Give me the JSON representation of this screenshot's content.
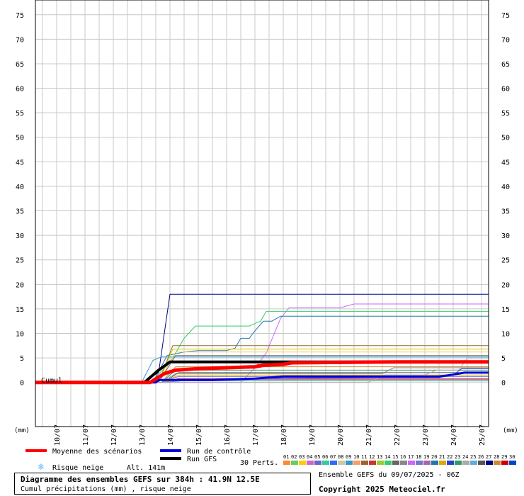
{
  "chart_data": {
    "type": "line",
    "y_ticks": [
      0,
      5,
      10,
      15,
      20,
      25,
      30,
      35,
      40,
      45,
      50,
      55,
      60,
      65,
      70,
      75
    ],
    "ylim": [
      -9,
      78
    ],
    "y_unit_label": "(mm)",
    "series_start_label": "Cumul",
    "x_tick_labels": [
      "10/07",
      "11/07",
      "12/07",
      "13/07",
      "14/07",
      "15/07",
      "16/07",
      "17/07",
      "18/07",
      "19/07",
      "20/07",
      "21/07",
      "22/07",
      "23/07",
      "24/07",
      "25/07"
    ],
    "x_tick_days": [
      1,
      2,
      3,
      4,
      5,
      6,
      7,
      8,
      9,
      10,
      11,
      12,
      13,
      14,
      15,
      16
    ],
    "x_day_range": [
      0.25,
      16.25
    ],
    "grid": true,
    "series": [
      {
        "color": "#00008b",
        "width": 1,
        "points": [
          [
            0.25,
            0
          ],
          [
            4.0,
            0
          ],
          [
            4.6,
            2
          ],
          [
            5.0,
            18
          ],
          [
            16.25,
            18
          ]
        ]
      },
      {
        "color": "#cc66ff",
        "width": 1,
        "points": [
          [
            0.25,
            0
          ],
          [
            7.5,
            0
          ],
          [
            8.0,
            3
          ],
          [
            8.4,
            6
          ],
          [
            8.9,
            13
          ],
          [
            9.2,
            15.2
          ],
          [
            11.0,
            15.2
          ],
          [
            11.5,
            16
          ],
          [
            16.25,
            16
          ]
        ]
      },
      {
        "color": "#33cc66",
        "width": 1,
        "points": [
          [
            0.25,
            0
          ],
          [
            4.3,
            0
          ],
          [
            5.0,
            4
          ],
          [
            5.5,
            9
          ],
          [
            5.9,
            11.5
          ],
          [
            7.8,
            11.5
          ],
          [
            8.2,
            12.5
          ],
          [
            8.4,
            14.5
          ],
          [
            16.25,
            14.5
          ]
        ]
      },
      {
        "color": "#2277aa",
        "width": 1,
        "points": [
          [
            0.25,
            0
          ],
          [
            4.4,
            0
          ],
          [
            4.9,
            5.5
          ],
          [
            5.5,
            6.2
          ],
          [
            6.0,
            6.5
          ],
          [
            7.0,
            6.5
          ],
          [
            7.3,
            7
          ],
          [
            7.5,
            9
          ],
          [
            7.8,
            9
          ],
          [
            8.0,
            10.5
          ],
          [
            8.3,
            12.5
          ],
          [
            8.6,
            12.5
          ],
          [
            8.9,
            13.5
          ],
          [
            16.25,
            13.5
          ]
        ]
      },
      {
        "color": "#3399cc",
        "width": 1,
        "points": [
          [
            0.25,
            0
          ],
          [
            4.0,
            0
          ],
          [
            4.4,
            4.5
          ],
          [
            4.7,
            5.2
          ],
          [
            16.25,
            5.2
          ]
        ]
      },
      {
        "color": "#996633",
        "width": 1,
        "points": [
          [
            0.25,
            0
          ],
          [
            4.6,
            0
          ],
          [
            5.1,
            7.5
          ],
          [
            16.25,
            7.5
          ]
        ]
      },
      {
        "color": "#cccc00",
        "width": 1,
        "points": [
          [
            0.25,
            0
          ],
          [
            4.6,
            0
          ],
          [
            5.1,
            6.8
          ],
          [
            16.25,
            6.8
          ]
        ]
      },
      {
        "color": "#ffcc66",
        "width": 1,
        "points": [
          [
            0.25,
            0
          ],
          [
            4.6,
            0
          ],
          [
            5.2,
            6.2
          ],
          [
            16.25,
            6.2
          ]
        ]
      },
      {
        "color": "#666666",
        "width": 1,
        "points": [
          [
            0.25,
            0
          ],
          [
            4.6,
            0
          ],
          [
            5.2,
            5.5
          ],
          [
            16.25,
            5.5
          ]
        ]
      },
      {
        "color": "#cc8833",
        "width": 1,
        "points": [
          [
            0.25,
            0
          ],
          [
            4.7,
            0
          ],
          [
            5.2,
            3.2
          ],
          [
            16.25,
            3.2
          ]
        ]
      },
      {
        "color": "#339966",
        "width": 1,
        "points": [
          [
            0.25,
            0
          ],
          [
            4.7,
            0
          ],
          [
            5.2,
            2.5
          ],
          [
            16.25,
            2.5
          ]
        ]
      },
      {
        "color": "#888888",
        "width": 1,
        "points": [
          [
            0.25,
            0
          ],
          [
            4.7,
            0
          ],
          [
            5.2,
            1.8
          ],
          [
            12.5,
            1.8
          ],
          [
            12.9,
            3
          ],
          [
            16.25,
            3
          ]
        ]
      },
      {
        "color": "#7777cc",
        "width": 1,
        "points": [
          [
            0.25,
            0
          ],
          [
            4.7,
            0
          ],
          [
            5.3,
            1.2
          ],
          [
            16.25,
            1.2
          ]
        ]
      },
      {
        "color": "#cc3333",
        "width": 1,
        "points": [
          [
            0.25,
            0
          ],
          [
            4.8,
            0
          ],
          [
            5.3,
            0.8
          ],
          [
            16.25,
            0.8
          ]
        ]
      },
      {
        "color": "#99cc33",
        "width": 1,
        "points": [
          [
            0.25,
            0
          ],
          [
            4.8,
            0
          ],
          [
            5.3,
            0.4
          ],
          [
            16.25,
            0.4
          ]
        ]
      },
      {
        "color": "#555555",
        "width": 1,
        "points": [
          [
            0.25,
            0
          ],
          [
            4.8,
            0
          ],
          [
            5.3,
            2.0
          ],
          [
            16.25,
            2.0
          ]
        ]
      },
      {
        "color": "#ddaa00",
        "width": 1,
        "points": [
          [
            0.25,
            0
          ],
          [
            4.8,
            0
          ],
          [
            5.3,
            1.5
          ],
          [
            16.25,
            1.5
          ]
        ]
      },
      {
        "color": "#aa66aa",
        "width": 1,
        "points": [
          [
            0.25,
            0
          ],
          [
            4.9,
            0
          ],
          [
            5.4,
            0.6
          ],
          [
            16.25,
            0.6
          ]
        ]
      },
      {
        "color": "#66aadd",
        "width": 1,
        "points": [
          [
            0.25,
            0
          ],
          [
            4.9,
            0
          ],
          [
            5.4,
            0.3
          ],
          [
            16.25,
            0.3
          ]
        ]
      },
      {
        "color": "#aaaaaa",
        "width": 1,
        "points": [
          [
            0.25,
            0
          ],
          [
            12.0,
            0
          ],
          [
            12.6,
            1.5
          ],
          [
            14.0,
            1.5
          ],
          [
            14.4,
            2.5
          ],
          [
            15.2,
            2.5
          ],
          [
            15.5,
            5
          ],
          [
            16.25,
            5
          ]
        ]
      },
      {
        "color": "#2244cc",
        "width": 1,
        "points": [
          [
            0.25,
            0
          ],
          [
            4.5,
            0
          ],
          [
            4.6,
            0.5
          ],
          [
            6.5,
            0.5
          ],
          [
            8.0,
            0.8
          ],
          [
            12.0,
            1
          ],
          [
            14.5,
            1
          ],
          [
            15.0,
            1.5
          ],
          [
            15.3,
            2.8
          ],
          [
            16.25,
            2.8
          ]
        ]
      },
      {
        "color": "#0000dd",
        "width": 3,
        "points": [
          [
            0.25,
            0
          ],
          [
            4.5,
            0
          ],
          [
            4.6,
            0.5
          ],
          [
            6.5,
            0.5
          ],
          [
            8.0,
            0.8
          ],
          [
            9.0,
            1.2
          ],
          [
            12.0,
            1.2
          ],
          [
            14.5,
            1.2
          ],
          [
            15.0,
            1.6
          ],
          [
            15.4,
            2.0
          ],
          [
            16.25,
            2.0
          ]
        ]
      },
      {
        "color": "#000000",
        "width": 4,
        "points": [
          [
            0.25,
            0
          ],
          [
            4.1,
            0
          ],
          [
            4.6,
            2.5
          ],
          [
            5.0,
            4.2
          ],
          [
            16.25,
            4.2
          ]
        ]
      },
      {
        "color": "#ff0000",
        "width": 5,
        "points": [
          [
            0.25,
            0
          ],
          [
            4.3,
            0
          ],
          [
            4.8,
            1.8
          ],
          [
            5.2,
            2.5
          ],
          [
            6.0,
            2.8
          ],
          [
            7.0,
            3.0
          ],
          [
            8.0,
            3.2
          ],
          [
            8.3,
            3.5
          ],
          [
            9.0,
            3.7
          ],
          [
            9.3,
            4.0
          ],
          [
            13.0,
            4.2
          ],
          [
            16.25,
            4.2
          ]
        ]
      }
    ]
  },
  "legend": {
    "mean_label": "Moyenne des scénarios",
    "mean_color": "#ff0000",
    "control_label": "Run de contrôle",
    "control_color": "#0000dd",
    "gfs_label": "Run GFS",
    "gfs_color": "#000000",
    "snow_label": "Risque neige",
    "snow_icon": "snowflake-icon",
    "snow_color": "#66bbff",
    "altitude_label": "Alt. 141m",
    "perts_label": "30 Perts.",
    "pert_numbers": [
      "01",
      "02",
      "03",
      "04",
      "05",
      "06",
      "07",
      "08",
      "09",
      "10",
      "11",
      "12",
      "13",
      "14",
      "15",
      "16",
      "17",
      "18",
      "19",
      "20",
      "21",
      "22",
      "23",
      "24",
      "25",
      "26",
      "27",
      "28",
      "29",
      "30"
    ],
    "pert_colors": [
      "#ff8833",
      "#66cc66",
      "#ffcc00",
      "#cc66cc",
      "#6666cc",
      "#33cc99",
      "#3366ff",
      "#cccc99",
      "#3399cc",
      "#ff9966",
      "#996633",
      "#cc3333",
      "#99cc33",
      "#33cc66",
      "#666666",
      "#888888",
      "#cc66ff",
      "#7777cc",
      "#aa66aa",
      "#2277aa",
      "#ddaa00",
      "#2244cc",
      "#339966",
      "#aaaaaa",
      "#66aadd",
      "#555555",
      "#00008b",
      "#cc8833",
      "#cc0000",
      "#0044cc"
    ]
  },
  "footer": {
    "title": "Diagramme des ensembles GEFS sur 384h : 41.9N 12.5E",
    "subtitle": "Cumul précipitations (mm) , risque neige",
    "run_info": "Ensemble GEFS du 09/07/2025 - 06Z",
    "copyright": "Copyright 2025 Meteociel.fr"
  }
}
